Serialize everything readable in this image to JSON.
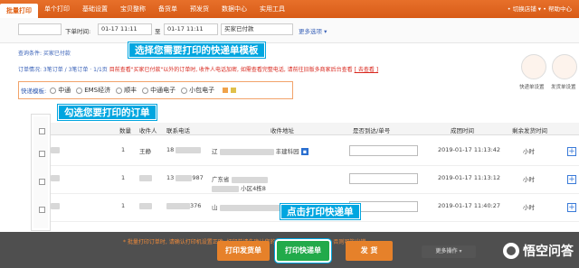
{
  "nav": {
    "tabs": [
      "批量打印",
      "单个打印",
      "基础设置",
      "宝贝整称",
      "备货单",
      "预发货",
      "数据中心",
      "实用工具"
    ],
    "user_text": "•  切换店铺 ▾  • 帮助中心"
  },
  "filters": {
    "date_label": "下单时间:",
    "date_from": "01-17 11:11",
    "to": "至",
    "date_to": "01-17 11:11",
    "status_select": "买家已付款",
    "more": "更多选项 ▾"
  },
  "info": {
    "line1": "查询条件:  买家已付款",
    "line2_prefix": "订单情况:  3笔订单 / 3笔订单 · 1/1页",
    "line2_red": "目前查看\"买家已付款\"以外的订单时, 收件人电话加密, 如需查看完整电话, 请前往旧版多商家后台查看",
    "line2_link": "[ 去查看 ]"
  },
  "callouts": {
    "template": "选择您需要打印的快递单模板",
    "select_orders": "勾选您要打印的订单",
    "click_print": "点击打印快递单"
  },
  "templates": {
    "label": "快递模板:",
    "options": [
      "中通",
      "EMS经济",
      "顺丰",
      "中通电子",
      "小包电子"
    ]
  },
  "right_panel": {
    "labels": [
      "快递单设置",
      "发货单设置"
    ]
  },
  "table": {
    "headers": [
      "数量",
      "收件人",
      "联系电话",
      "收件地址",
      "是否到达/单号",
      "成团时间",
      "剩余发货时间"
    ],
    "rows": [
      {
        "qty": "1",
        "name": "王静",
        "phone": "18",
        "address": "辽",
        "addr_tag": "丰建科园",
        "time": "2019-01-17 11:13:42",
        "remain": "小时"
      },
      {
        "qty": "1",
        "name": "",
        "phone": "13",
        "address": "广东省",
        "addr_tag": "小区4栋8",
        "time": "2019-01-17 11:13:12",
        "remain": "小时"
      },
      {
        "qty": "1",
        "name": "",
        "phone": "",
        "address": "山",
        "addr_tag": "",
        "time": "2019-01-17 11:40:27",
        "remain": "小时"
      }
    ],
    "phone_suffix": [
      "",
      "987",
      "376"
    ]
  },
  "bottom": {
    "hint": "* 批量打印订单时, 请确认打印机设置正确, 打印前请先确认您的快递单号是否足够打印, 否则可能出错...",
    "buttons": {
      "print_invoice": "打印发货单",
      "print_express": "打印快递单",
      "ship": "发 货",
      "more": "更多操作 ▾"
    }
  },
  "watermark": "悟空问答",
  "colors": {
    "accent": "#e06318",
    "callout": "#00a6e0",
    "print_express": "#22aa4a",
    "ship": "#e6812a"
  }
}
